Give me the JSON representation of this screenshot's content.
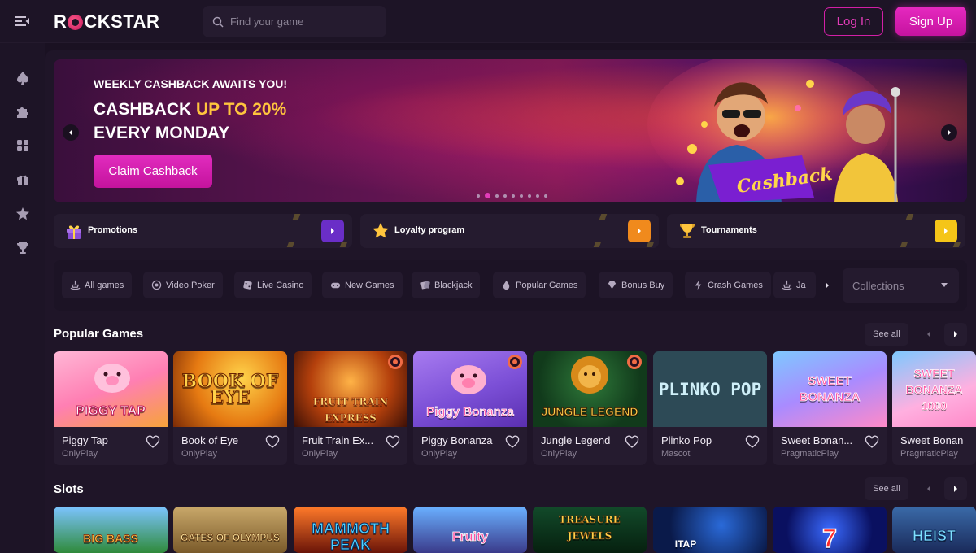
{
  "header": {
    "logo_text_a": "R",
    "logo_text_b": "CKSTAR",
    "search_placeholder": "Find your game",
    "login_label": "Log In",
    "signup_label": "Sign Up"
  },
  "sidebar": {
    "icons": [
      "spade-icon",
      "puzzle-icon",
      "grid-icon",
      "gift-icon",
      "star-icon",
      "trophy-icon"
    ]
  },
  "banner": {
    "subtitle": "WEEKLY CASHBACK AWAITS YOU!",
    "title_prefix": "CASHBACK ",
    "title_highlight": "UP TO 20%",
    "title_line2": "EVERY MONDAY",
    "cta": "Claim Cashback",
    "art_text": "Cashback",
    "slide_count": 9,
    "active_slide": 2
  },
  "quick_links": [
    {
      "label": "Promotions",
      "icon": "gift-icon",
      "arrow_color": "#6a2ec7"
    },
    {
      "label": "Loyalty program",
      "icon": "star-icon",
      "arrow_color": "#f08a1d"
    },
    {
      "label": "Tournaments",
      "icon": "trophy-icon",
      "arrow_color": "#f5c518"
    }
  ],
  "categories": {
    "chips": [
      "All games",
      "Video Poker",
      "Live Casino",
      "New Games",
      "Blackjack",
      "Popular Games",
      "Bonus Buy",
      "Crash Games",
      "Ja"
    ],
    "collections_placeholder": "Collections"
  },
  "popular": {
    "title": "Popular Games",
    "see_all": "See all",
    "games": [
      {
        "name": "Piggy Tap",
        "provider": "OnlyPlay",
        "art": "PIGGY TAP"
      },
      {
        "name": "Book of Eye",
        "provider": "OnlyPlay",
        "art": "BOOK OF EYE"
      },
      {
        "name": "Fruit Train Ex...",
        "provider": "OnlyPlay",
        "art": "FRUIT TRAIN EXPRESS"
      },
      {
        "name": "Piggy Bonanza",
        "provider": "OnlyPlay",
        "art": "Piggy Bonanza"
      },
      {
        "name": "Jungle Legend",
        "provider": "OnlyPlay",
        "art": "JUNGLE LEGEND"
      },
      {
        "name": "Plinko Pop",
        "provider": "Mascot",
        "art": "PLINKO POP"
      },
      {
        "name": "Sweet Bonan...",
        "provider": "PragmaticPlay",
        "art": "SWEET BONANZA"
      },
      {
        "name": "Sweet Bonan",
        "provider": "PragmaticPlay",
        "art": "SWEET BONANZA 1000"
      }
    ]
  },
  "slots": {
    "title": "Slots",
    "see_all": "See all",
    "games": [
      {
        "art": "BIG BASS"
      },
      {
        "art": "GATES OF OLYMPUS"
      },
      {
        "art": "MAMMOTH PEAK"
      },
      {
        "art": "Fruity"
      },
      {
        "art": "TREASURE JEWELS"
      },
      {
        "art": "ITAP"
      },
      {
        "art": "7"
      },
      {
        "art": "HEIST"
      }
    ]
  },
  "colors": {
    "accent": "#e22cbf",
    "highlight": "#ffc53d",
    "background": "#1a1122",
    "panel": "#251b2f"
  }
}
